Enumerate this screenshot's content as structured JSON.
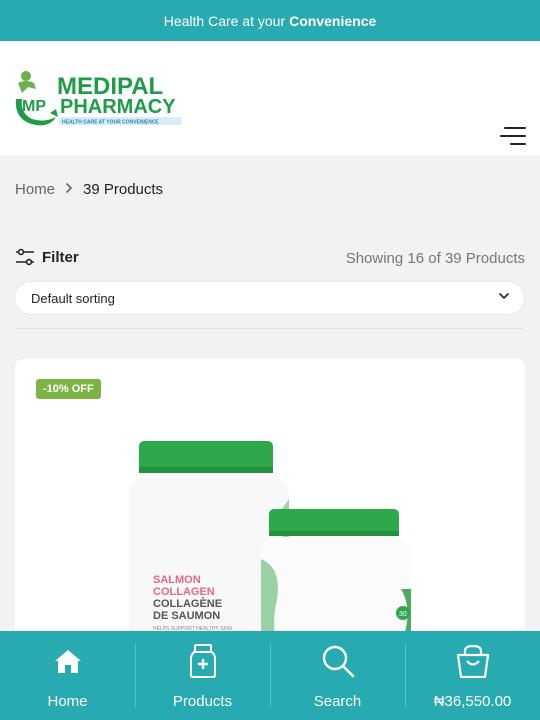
{
  "topbar": {
    "text_prefix": "Health Care at your",
    "text_bold": "Convenience"
  },
  "logo": {
    "mark": "MP",
    "line1": "MEDIPAL",
    "line2": "PHARMACY",
    "tagline": "HEALTH CARE AT YOUR CONVENIENCE"
  },
  "breadcrumb": {
    "home": "Home",
    "current": "39 Products"
  },
  "toolbar": {
    "filter_label": "Filter",
    "showing": "Showing 16 of 39 Products"
  },
  "sort": {
    "selected": "Default sorting"
  },
  "product": {
    "badge": "-10% OFF",
    "label_line1": "SALMON",
    "label_line2": "COLLAGEN",
    "label_line3": "COLLAGÈNE",
    "label_line4": "DE SAUMON",
    "label_small": "HELPS SUPPORT HEALTHY SKIN",
    "small_jar_count": "30"
  },
  "bottom_nav": {
    "home": "Home",
    "products": "Products",
    "search": "Search",
    "cart_total": "₦36,550.00"
  },
  "icons": [
    "hamburger-icon",
    "chevron-right-icon",
    "filter-sliders-icon",
    "chevron-down-icon",
    "home-icon",
    "medicine-bottle-icon",
    "search-icon",
    "shopping-bag-icon"
  ],
  "colors": {
    "primary": "#27aab0",
    "logo_green": "#1f9c48",
    "badge_green": "#7cb342",
    "cap_green": "#2ea84a"
  }
}
